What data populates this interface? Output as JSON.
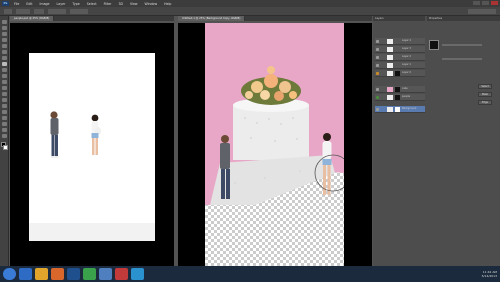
{
  "menu": {
    "logo": "Ps",
    "items": [
      "File",
      "Edit",
      "Image",
      "Layer",
      "Type",
      "Select",
      "Filter",
      "3D",
      "View",
      "Window",
      "Help"
    ]
  },
  "documents": [
    {
      "tab": "people.psd @ 25% (RGB/8)",
      "status": "25%"
    },
    {
      "tab": "Untitled-1 @ 25% (Background Copy, RGB/8)",
      "status": "25%"
    }
  ],
  "panels": {
    "layers_tab": "Layers",
    "adjust_tab": "Properties",
    "layers": [
      {
        "name": "Layer 4"
      },
      {
        "name": "Layer 3"
      },
      {
        "name": "Layer 2"
      },
      {
        "name": "Layer 1"
      },
      {
        "name": "Layer 0"
      },
      {
        "name": "cake"
      },
      {
        "name": "people"
      },
      {
        "name": "Background"
      }
    ],
    "buttons": [
      "Select",
      "Mask",
      "Edge"
    ]
  },
  "taskbar": {
    "time": "11:42 AM",
    "date": "5/14/2013"
  },
  "colors": {
    "pink_bg": "#e8a7c7",
    "selection": "#5a7bb0",
    "taskbar": "#1b2a3c"
  }
}
